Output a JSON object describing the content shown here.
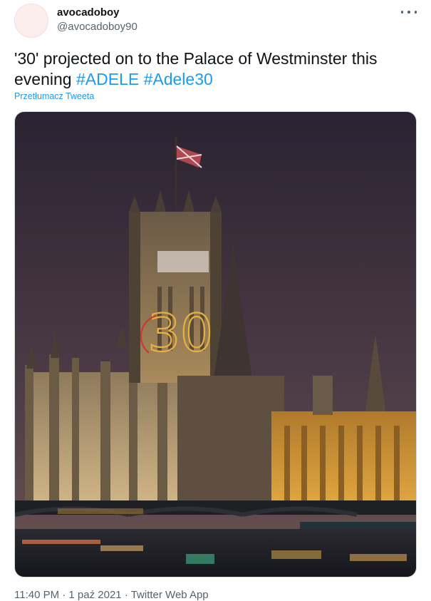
{
  "user": {
    "display_name": "avocadoboy",
    "handle": "@avocadoboy90"
  },
  "tweet": {
    "text": "'30' projected on to the Palace of Westminster this evening ",
    "hashtags": [
      "#ADELE",
      "#Adele30"
    ],
    "translate_label": "Przetłumacz Tweeta",
    "projection_text": "30",
    "timestamp_line": "11:40 PM · 1 paź 2021 · Twitter Web App"
  },
  "icons": {
    "more": "more-horizontal-icon"
  },
  "colors": {
    "link": "#1d9bf0",
    "secondary": "#536471",
    "primary": "#0f1419"
  }
}
